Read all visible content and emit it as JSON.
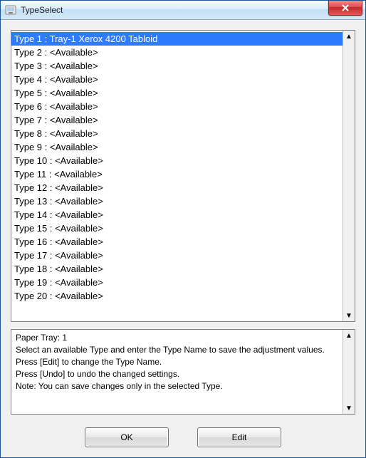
{
  "window": {
    "title": "TypeSelect"
  },
  "type_list": [
    {
      "label": "Type 1 : Tray-1 Xerox 4200 Tabloid",
      "selected": true
    },
    {
      "label": "Type 2 : <Available>",
      "selected": false
    },
    {
      "label": "Type 3 : <Available>",
      "selected": false
    },
    {
      "label": "Type 4 : <Available>",
      "selected": false
    },
    {
      "label": "Type 5 : <Available>",
      "selected": false
    },
    {
      "label": "Type 6 : <Available>",
      "selected": false
    },
    {
      "label": "Type 7 : <Available>",
      "selected": false
    },
    {
      "label": "Type 8 : <Available>",
      "selected": false
    },
    {
      "label": "Type 9 : <Available>",
      "selected": false
    },
    {
      "label": "Type 10 : <Available>",
      "selected": false
    },
    {
      "label": "Type 11 : <Available>",
      "selected": false
    },
    {
      "label": "Type 12 : <Available>",
      "selected": false
    },
    {
      "label": "Type 13 : <Available>",
      "selected": false
    },
    {
      "label": "Type 14 : <Available>",
      "selected": false
    },
    {
      "label": "Type 15 : <Available>",
      "selected": false
    },
    {
      "label": "Type 16 : <Available>",
      "selected": false
    },
    {
      "label": "Type 17 : <Available>",
      "selected": false
    },
    {
      "label": "Type 18 : <Available>",
      "selected": false
    },
    {
      "label": "Type 19 : <Available>",
      "selected": false
    },
    {
      "label": "Type 20 : <Available>",
      "selected": false
    }
  ],
  "info": {
    "line1": "Paper Tray: 1",
    "line2": "Select an available Type and enter the Type Name to save the adjustment values.",
    "line3": "Press [Edit] to change the Type Name.",
    "line4": "Press [Undo] to undo the changed settings.",
    "line5": "Note: You can save changes only in the selected Type."
  },
  "buttons": {
    "ok": "OK",
    "edit": "Edit"
  }
}
